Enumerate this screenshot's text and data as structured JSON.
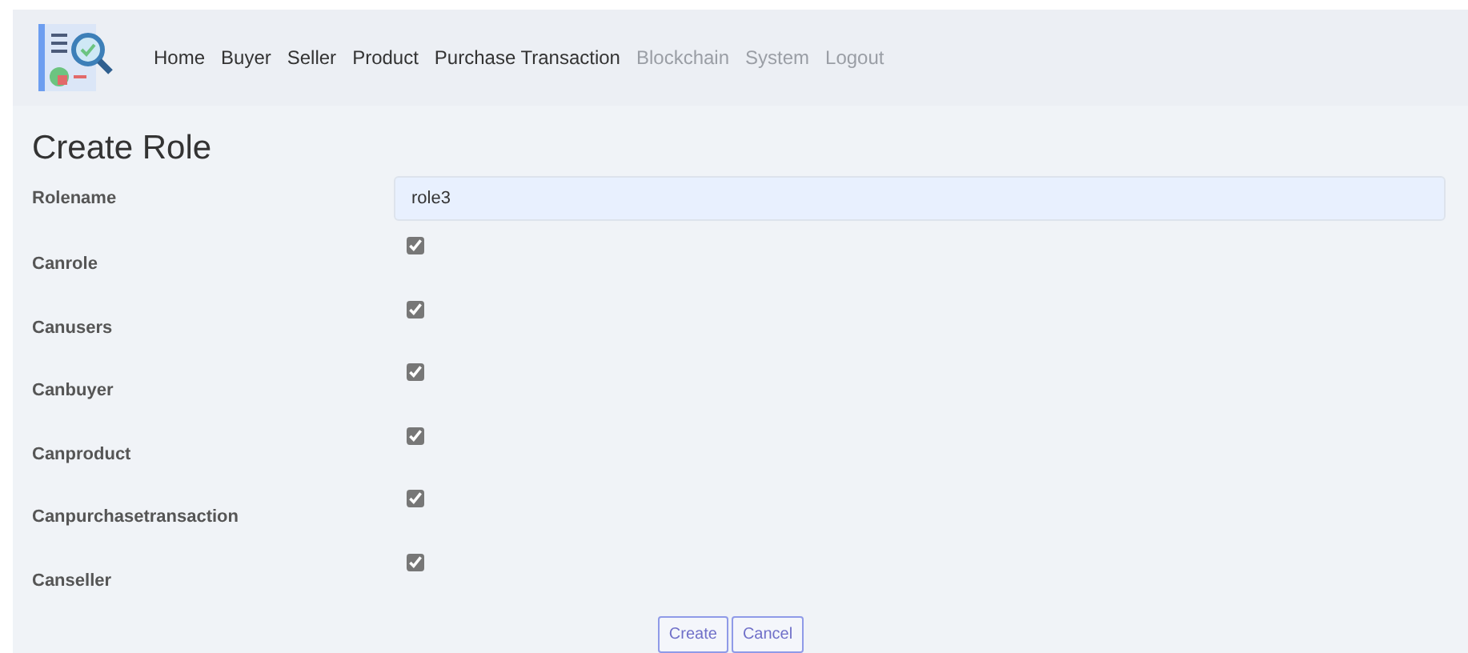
{
  "nav": [
    {
      "label": "Home",
      "disabled": false
    },
    {
      "label": "Buyer",
      "disabled": false
    },
    {
      "label": "Seller",
      "disabled": false
    },
    {
      "label": "Product",
      "disabled": false
    },
    {
      "label": "Purchase Transaction",
      "disabled": false
    },
    {
      "label": "Blockchain",
      "disabled": true
    },
    {
      "label": "System",
      "disabled": true
    },
    {
      "label": "Logout",
      "disabled": true
    }
  ],
  "title": "Create Role",
  "rolename": {
    "label": "Rolename",
    "value": "role3"
  },
  "permissions": [
    {
      "label": "Canrole",
      "checked": true
    },
    {
      "label": "Canusers",
      "checked": true
    },
    {
      "label": "Canbuyer",
      "checked": true
    },
    {
      "label": "Canproduct",
      "checked": true
    },
    {
      "label": "Canpurchasetransaction",
      "checked": true
    },
    {
      "label": "Canseller",
      "checked": true
    }
  ],
  "buttons": [
    "Create",
    "Cancel"
  ]
}
